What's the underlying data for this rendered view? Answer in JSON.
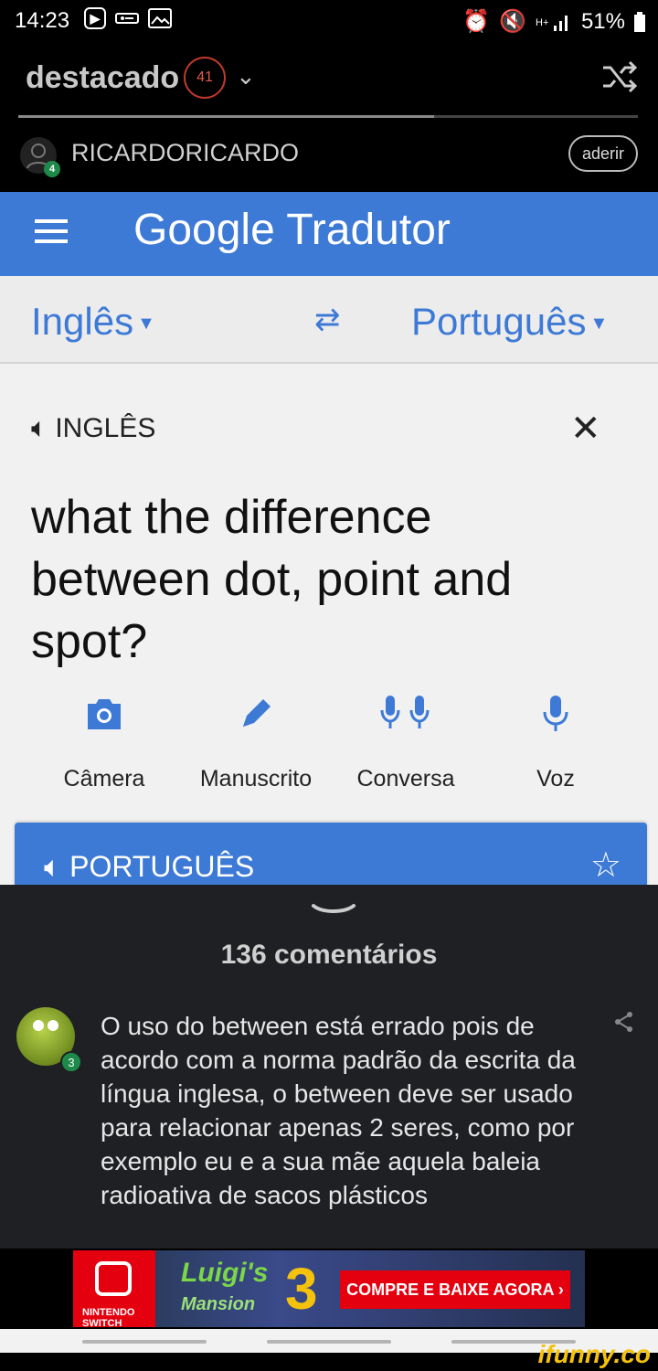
{
  "status_bar": {
    "time": "14:23",
    "battery": "51%"
  },
  "feed_header": {
    "title": "destacado",
    "count": "41"
  },
  "post_author": {
    "username": "RICARDORICARDO",
    "level": "4",
    "follow_label": "aderir"
  },
  "google_translate": {
    "app_title": "Google Tradutor",
    "source_language": "Inglês",
    "target_language": "Português",
    "source_label": "INGLÊS",
    "source_text": "what the difference between dot, point and spot?",
    "tools": [
      {
        "label": "Câmera",
        "icon": "camera-icon"
      },
      {
        "label": "Manuscrito",
        "icon": "pen-icon"
      },
      {
        "label": "Conversa",
        "icon": "dual-mic-icon"
      },
      {
        "label": "Voz",
        "icon": "mic-icon"
      }
    ],
    "result_label": "PORTUGUÊS"
  },
  "comments": {
    "count_label": "136 comentários",
    "first": {
      "level": "3",
      "text": "O uso do between está errado pois de acordo com a norma padrão da escrita da língua inglesa, o between deve ser usado para relacionar apenas 2 seres, como por exemplo eu e a sua mãe aquela baleia radioativa de sacos plásticos"
    }
  },
  "ad": {
    "brand": "NINTENDO SWITCH",
    "game_line1": "Luigi's",
    "game_line2": "Mansion",
    "game_number": "3",
    "cta": "COMPRE E BAIXE AGORA ›"
  },
  "watermark": "ifunny.co",
  "colors": {
    "translate_blue": "#3d7ad6",
    "badge_red": "#c0392b",
    "level_green": "#1e8a4a",
    "comments_bg": "#1f2024"
  }
}
